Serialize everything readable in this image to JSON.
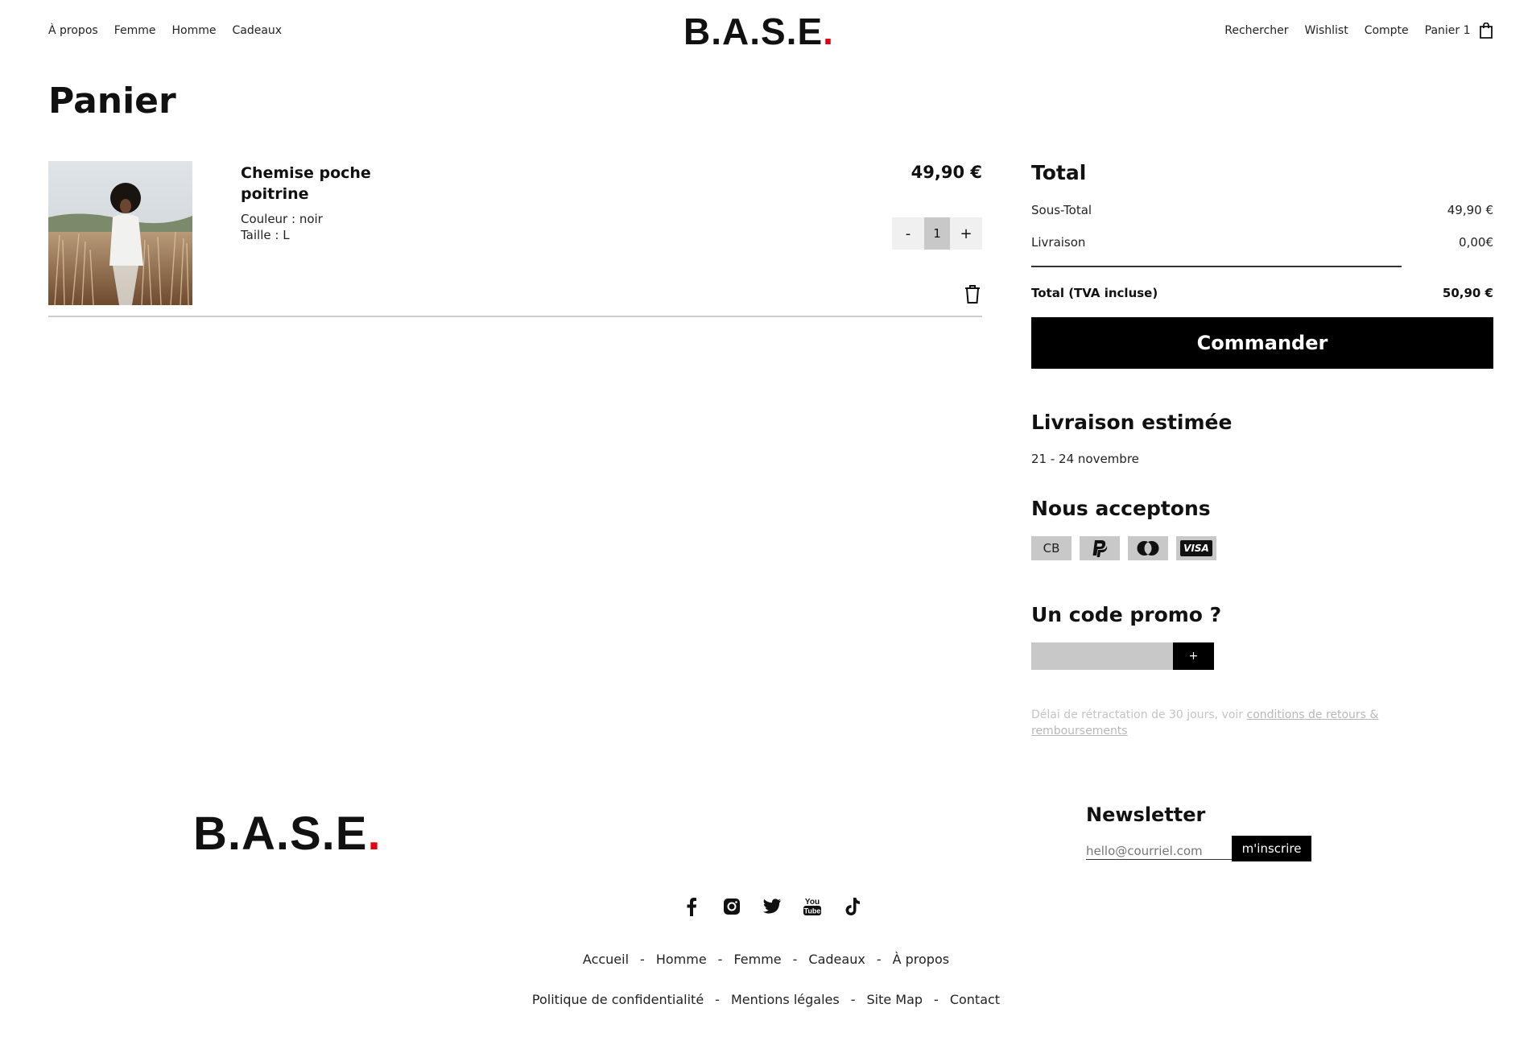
{
  "header": {
    "nav_left": [
      "À propos",
      "Femme",
      "Homme",
      "Cadeaux"
    ],
    "logo_text": "B.A.S.E",
    "logo_dot": ".",
    "nav_right": [
      "Rechercher",
      "Wishlist",
      "Compte",
      "Panier 1"
    ]
  },
  "page_title": "Panier",
  "item": {
    "name": "Chemise poche poitrine",
    "color": "Couleur : noir",
    "size": "Taille : L",
    "price": "49,90 €",
    "quantity": "1",
    "minus": "-",
    "plus": "+"
  },
  "summary": {
    "title": "Total",
    "subtotal_label": "Sous-Total",
    "subtotal_value": "49,90 €",
    "shipping_label": "Livraison",
    "shipping_value": "0,00€",
    "total_label": "Total (TVA incluse)",
    "total_value": "50,90 €",
    "checkout_label": "Commander"
  },
  "delivery": {
    "title": "Livraison estimée",
    "dates": "21 - 24 novembre"
  },
  "payments": {
    "title": "Nous acceptons",
    "cb_label": "CB",
    "visa_label": "VISA"
  },
  "promo": {
    "title": "Un code promo ?",
    "button": "+"
  },
  "legal": {
    "text": "Délai de rétractation de 30 jours, voir ",
    "link": "conditions de retours & remboursements"
  },
  "footer": {
    "logo_text": "B.A.S.E",
    "logo_dot": ".",
    "newsletter_title": "Newsletter",
    "newsletter_placeholder": "hello@courriel.com",
    "newsletter_button": "m'inscrire",
    "nav": [
      "Accueil",
      "Homme",
      "Femme",
      "Cadeaux",
      "À propos"
    ],
    "nav2": [
      "Politique de confidentialité",
      "Mentions légales",
      "Site Map",
      "Contact"
    ],
    "separator": "-"
  },
  "colors": {
    "accent_red": "#e3000f",
    "button_black": "#000000",
    "gray_fill": "#c8c8c8"
  }
}
